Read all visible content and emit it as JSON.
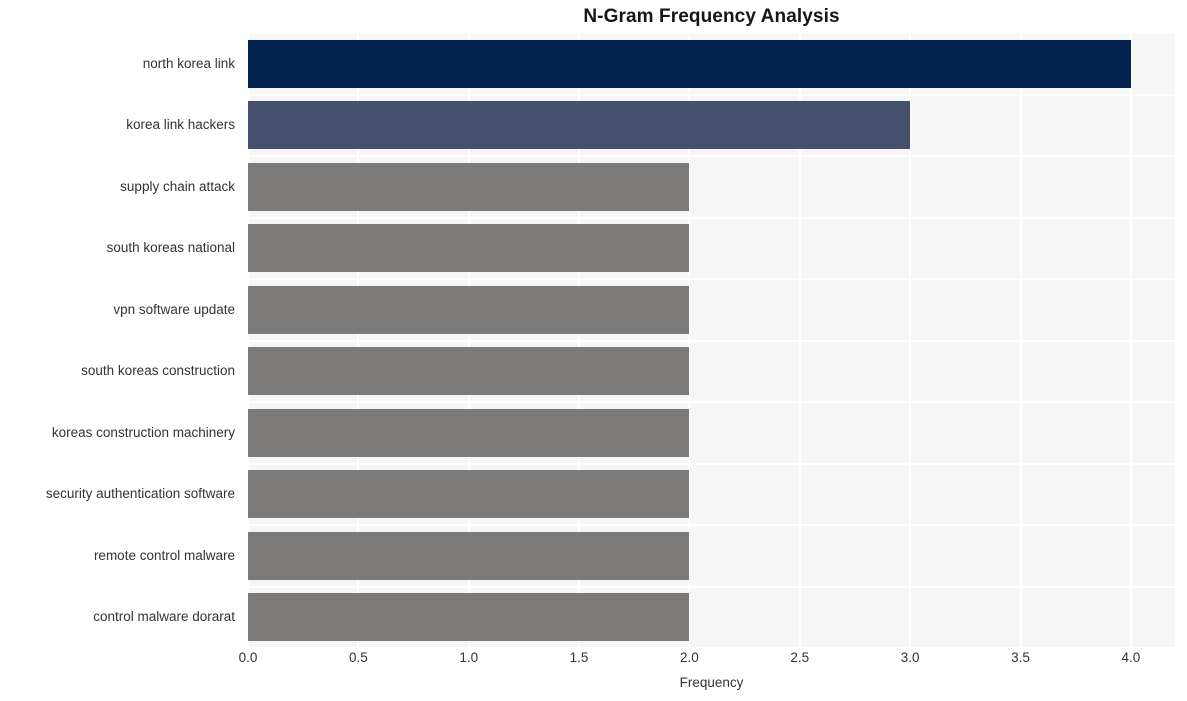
{
  "chart_data": {
    "type": "bar",
    "orientation": "horizontal",
    "title": "N-Gram Frequency Analysis",
    "xlabel": "Frequency",
    "ylabel": "",
    "xlim": [
      0.0,
      4.2
    ],
    "xticks": [
      "0.0",
      "0.5",
      "1.0",
      "1.5",
      "2.0",
      "2.5",
      "3.0",
      "3.5",
      "4.0"
    ],
    "xtick_values": [
      0.0,
      0.5,
      1.0,
      1.5,
      2.0,
      2.5,
      3.0,
      3.5,
      4.0
    ],
    "grid": true,
    "legend": "none",
    "categories": [
      "north korea link",
      "korea link hackers",
      "supply chain attack",
      "south koreas national",
      "vpn software update",
      "south koreas construction",
      "koreas construction machinery",
      "security authentication software",
      "remote control malware",
      "control malware dorarat"
    ],
    "values": [
      4,
      3,
      2,
      2,
      2,
      2,
      2,
      2,
      2,
      2
    ],
    "bar_colors": [
      "#022350",
      "#44506e",
      "#7b7a78",
      "#7b7a78",
      "#7b7a78",
      "#7b7a78",
      "#7b7a78",
      "#7b7a78",
      "#7b7a78",
      "#7b7a78"
    ],
    "plot_background": "#f6f6f7",
    "gridline_color": "#ffffff",
    "figure_background": "#ffffff",
    "text_color": "#333333",
    "title_color": "#161616"
  }
}
